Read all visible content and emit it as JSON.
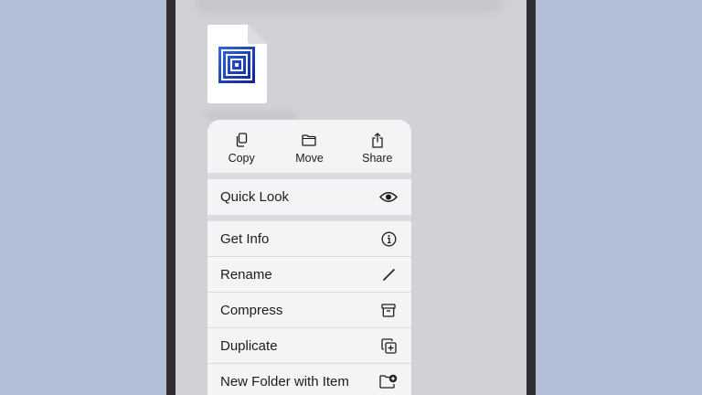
{
  "context_menu": {
    "quick_actions": [
      {
        "label": "Copy",
        "icon": "copy-icon"
      },
      {
        "label": "Move",
        "icon": "folder-icon"
      },
      {
        "label": "Share",
        "icon": "share-icon"
      }
    ],
    "primary": {
      "label": "Quick Look",
      "icon": "eye-icon"
    },
    "items": [
      {
        "label": "Get Info",
        "icon": "info-icon"
      },
      {
        "label": "Rename",
        "icon": "pencil-icon"
      },
      {
        "label": "Compress",
        "icon": "archive-box-icon"
      },
      {
        "label": "Duplicate",
        "icon": "duplicate-icon"
      },
      {
        "label": "New Folder with Item",
        "icon": "folder-add-icon"
      }
    ]
  },
  "file": {
    "icon": "document-thumbnail-icon",
    "accent_color": "#1833b5"
  },
  "colors": {
    "background": "#b2bfd6",
    "device_frame": "#2f2f31",
    "screen": "#d1d1d6",
    "menu": "#f4f4f6",
    "separator": "#dcdce0",
    "text": "#1c1c1e"
  }
}
